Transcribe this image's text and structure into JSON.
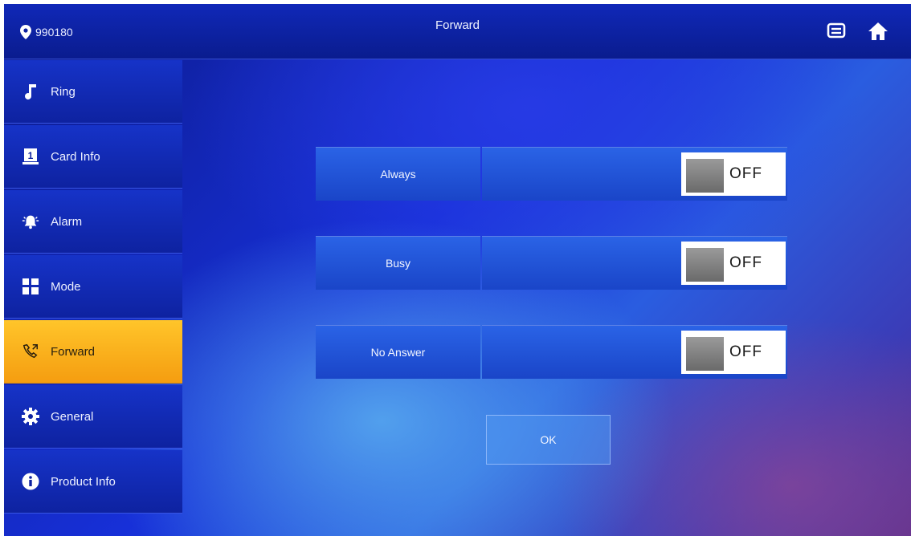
{
  "header": {
    "device_id": "990180",
    "title": "Forward",
    "icons": [
      "location-pin-icon",
      "message-icon",
      "home-icon"
    ]
  },
  "sidebar": {
    "items": [
      {
        "label": "Ring",
        "icon": "music-note-icon",
        "active": false
      },
      {
        "label": "Card Info",
        "icon": "card-icon",
        "active": false
      },
      {
        "label": "Alarm",
        "icon": "alarm-icon",
        "active": false
      },
      {
        "label": "Mode",
        "icon": "mode-grid-icon",
        "active": false
      },
      {
        "label": "Forward",
        "icon": "call-forward-icon",
        "active": true
      },
      {
        "label": "General",
        "icon": "gear-icon",
        "active": false
      },
      {
        "label": "Product Info",
        "icon": "info-icon",
        "active": false
      }
    ]
  },
  "forward": {
    "rows": [
      {
        "label": "Always",
        "value": "",
        "toggle": "OFF"
      },
      {
        "label": "Busy",
        "value": "",
        "toggle": "OFF"
      },
      {
        "label": "No Answer",
        "value": "",
        "toggle": "OFF"
      }
    ],
    "ok_label": "OK"
  },
  "colors": {
    "active_item": "#f8b31c",
    "sidebar_item": "#1633c8",
    "header": "#0e22a8",
    "toggle_bg": "#ffffff"
  }
}
